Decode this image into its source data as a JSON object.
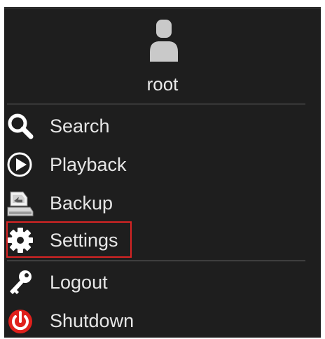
{
  "user": {
    "name": "root",
    "avatar_icon": "user-avatar-icon"
  },
  "menu": {
    "items": [
      {
        "id": "search",
        "label": "Search",
        "icon": "search-icon"
      },
      {
        "id": "playback",
        "label": "Playback",
        "icon": "play-circle-icon"
      },
      {
        "id": "backup",
        "label": "Backup",
        "icon": "backup-drive-icon"
      },
      {
        "id": "settings",
        "label": "Settings",
        "icon": "gear-icon",
        "highlighted": true
      },
      {
        "id": "logout",
        "label": "Logout",
        "icon": "key-icon"
      },
      {
        "id": "shutdown",
        "label": "Shutdown",
        "icon": "power-icon"
      }
    ]
  },
  "colors": {
    "panel_background": "#1e1e1e",
    "text": "#e6e6e6",
    "highlight_border": "#d92424",
    "shutdown_icon": "#e0201c"
  }
}
